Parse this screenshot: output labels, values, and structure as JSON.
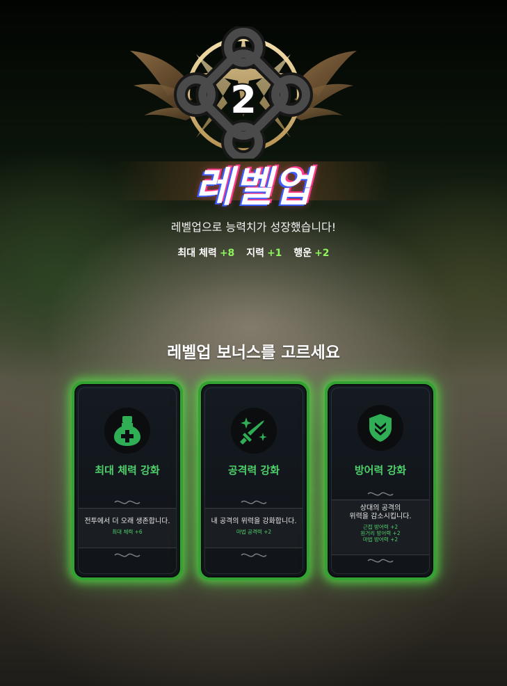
{
  "level": {
    "number": "2",
    "title": "레벨업"
  },
  "message": "레벨업으로 능력치가 성장했습니다!",
  "stats": [
    {
      "name": "최대 체력",
      "value": "+8"
    },
    {
      "name": "지력",
      "value": "+1"
    },
    {
      "name": "행운",
      "value": "+2"
    }
  ],
  "bonus_title": "레벨업 보너스를 고르세요",
  "cards": [
    {
      "name": "최대 체력 강화",
      "desc": [
        "전투에서 더 오래 생존합니다."
      ],
      "bonuses": [
        "최대 체력 +6"
      ],
      "icon": "potion-icon"
    },
    {
      "name": "공격력 강화",
      "desc": [
        "내 공격의 위력을 강화합니다."
      ],
      "bonuses": [
        "마법 공격력 +2"
      ],
      "icon": "sword-sparkle-icon"
    },
    {
      "name": "방어력 강화",
      "desc": [
        "상대의 공격의",
        "위력을 감소시킵니다."
      ],
      "bonuses": [
        "근접 방어력 +2",
        "원거리 방어력 +2",
        "마법 방어력 +2"
      ],
      "icon": "shield-icon"
    }
  ],
  "colors": {
    "accent_green": "#4fcf6a",
    "stat_green": "#8ef55c",
    "card_border": "#33a232"
  }
}
